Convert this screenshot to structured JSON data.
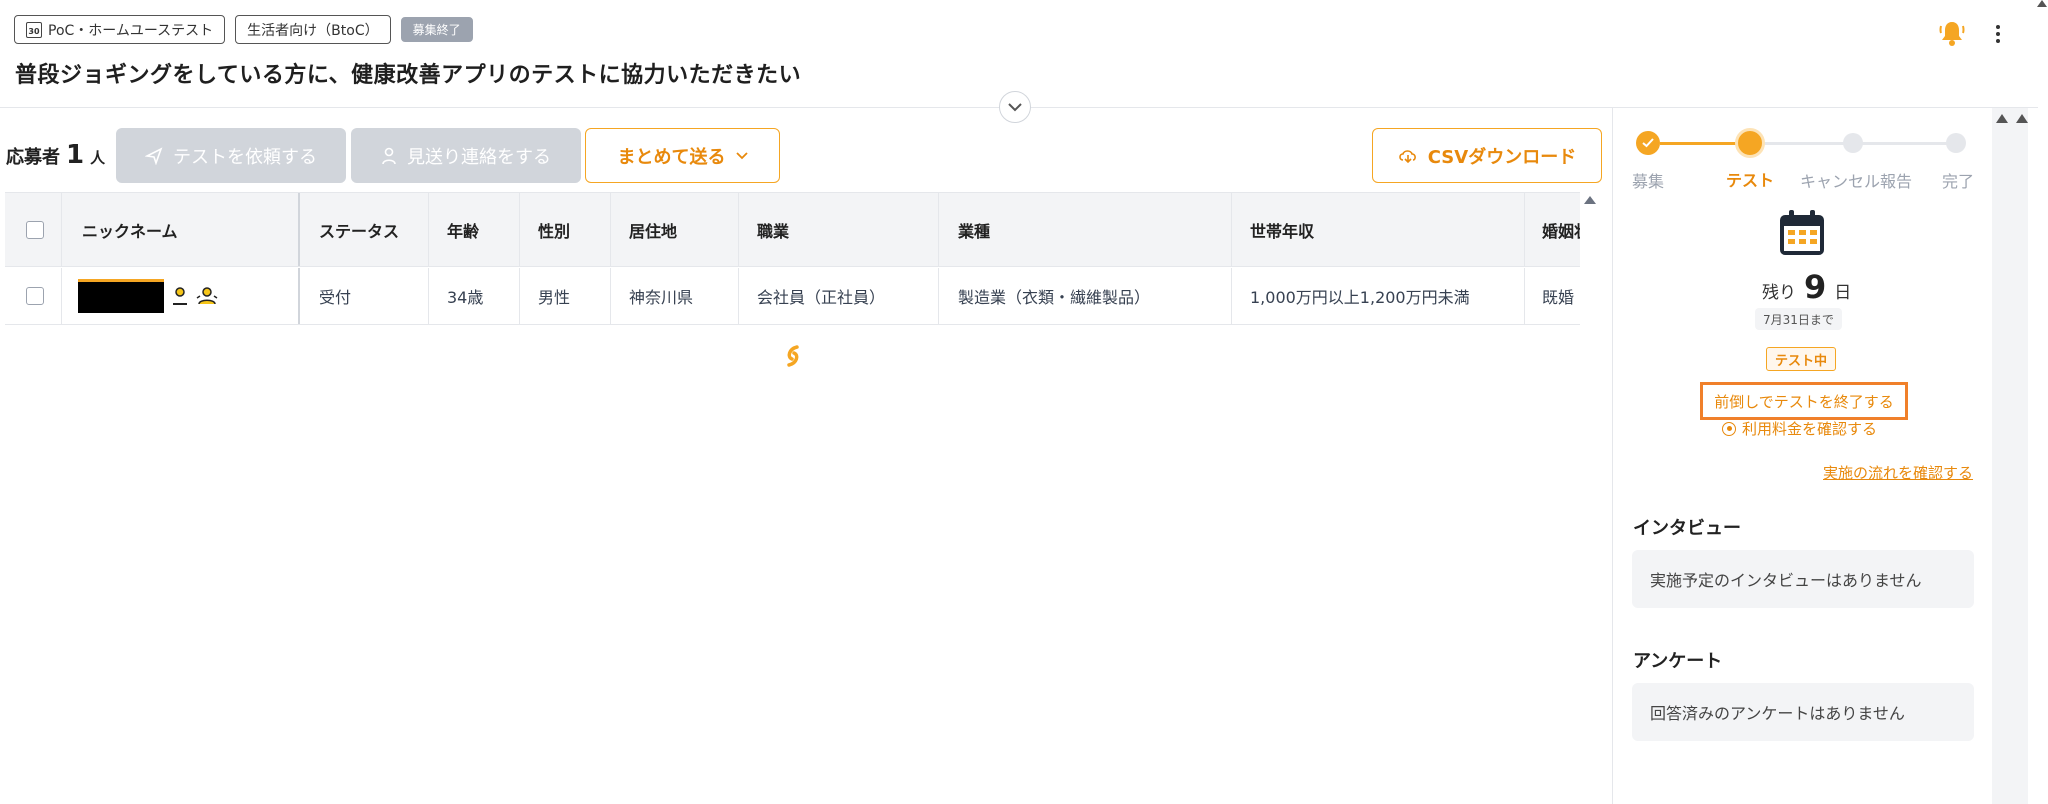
{
  "header": {
    "tags": [
      {
        "label": "PoC・ホームユーステスト",
        "icon": "calendar-30-icon"
      },
      {
        "label": "生活者向け（BtoC）"
      },
      {
        "label": "募集終了",
        "style": "gray"
      }
    ],
    "title": "普段ジョギングをしている方に、健康改善アプリのテストに協力いただきたい",
    "calendar_icon_text": "30"
  },
  "toolbar": {
    "applicants_label": "応募者",
    "applicants_count": "1",
    "applicants_unit": "人",
    "request_test_label": "テストを依頼する",
    "skip_contact_label": "見送り連絡をする",
    "bulk_send_label": "まとめて送る",
    "csv_download_label": "CSVダウンロード"
  },
  "table": {
    "columns": [
      "ニックネーム",
      "ステータス",
      "年齢",
      "性別",
      "居住地",
      "職業",
      "業種",
      "世帯年収",
      "婚姻状況"
    ],
    "visible_last_column": "婚姻状",
    "rows": [
      {
        "nickname": "",
        "status": "受付",
        "age": "34歳",
        "gender": "男性",
        "residence": "神奈川県",
        "occupation": "会社員（正社員）",
        "industry": "製造業（衣類・繊維製品）",
        "income": "1,000万円以上1,200万円未満",
        "marital": "既婚"
      }
    ]
  },
  "progress": {
    "steps": [
      {
        "label": "募集",
        "state": "done"
      },
      {
        "label": "テスト",
        "state": "current"
      },
      {
        "label": "キャンセル報告",
        "state": "todo"
      },
      {
        "label": "完了",
        "state": "todo"
      }
    ],
    "remaining_prefix": "残り",
    "remaining_days": "9",
    "remaining_suffix": "日",
    "deadline": "7月31日まで",
    "status_badge": "テスト中",
    "early_end_label": "前倒しでテストを終了する",
    "fee_label": "利用料金を確認する",
    "flow_link": "実施の流れを確認する"
  },
  "interview": {
    "title": "インタビュー",
    "empty_text": "実施予定のインタビューはありません"
  },
  "survey": {
    "title": "アンケート",
    "empty_text": "回答済みのアンケートはありません"
  },
  "colors": {
    "accent": "#f5a623",
    "accent_text": "#e8890c",
    "disabled_button": "#d1d5db",
    "header_bg": "#f3f4f6"
  }
}
